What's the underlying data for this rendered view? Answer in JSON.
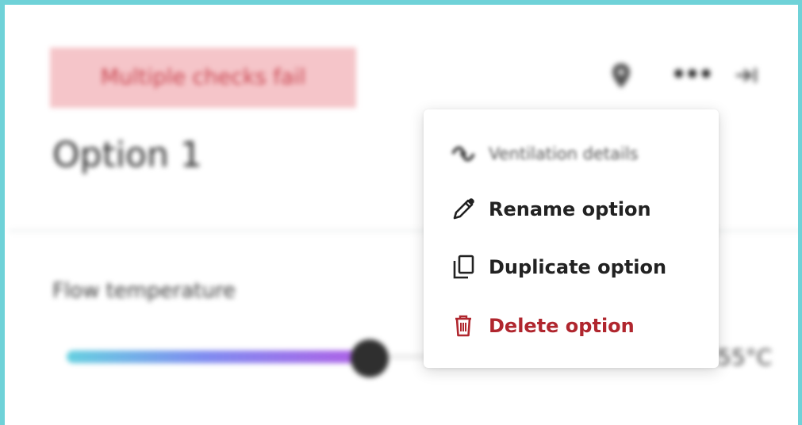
{
  "panel": {
    "status_badge": "Multiple checks fail",
    "title": "Option 1",
    "field_label": "Flow temperature",
    "slider": {
      "value_label": "55°C",
      "fill_fraction": 0.48
    },
    "header_icons": [
      "pin-icon",
      "more-icon",
      "collapse-icon"
    ]
  },
  "menu": {
    "items": [
      {
        "label": "Ventilation details",
        "icon": "fan-icon",
        "enabled": false
      },
      {
        "label": "Rename option",
        "icon": "pencil-icon",
        "enabled": true
      },
      {
        "label": "Duplicate option",
        "icon": "copy-icon",
        "enabled": true
      },
      {
        "label": "Delete option",
        "icon": "trash-icon",
        "enabled": true,
        "color": "#b0262e"
      }
    ]
  },
  "colors": {
    "frame_border": "#6fd2d8",
    "badge_bg": "#f5c5c9",
    "badge_text": "#c8444f",
    "danger": "#b0262e"
  }
}
